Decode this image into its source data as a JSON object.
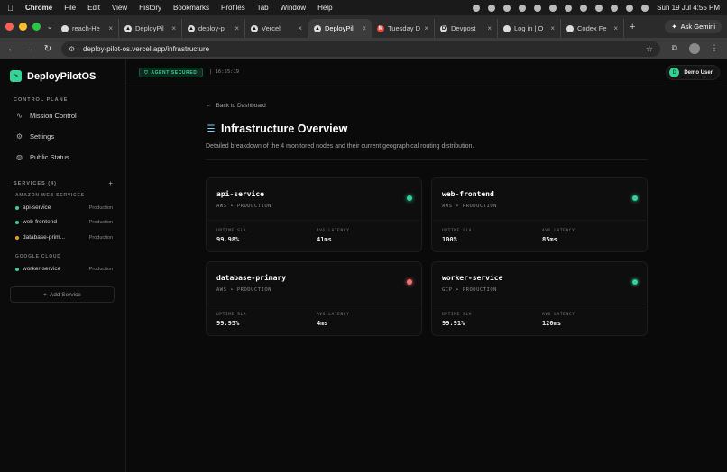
{
  "menubar": {
    "items": [
      "Chrome",
      "File",
      "Edit",
      "View",
      "History",
      "Bookmarks",
      "Profiles",
      "Tab",
      "Window",
      "Help"
    ],
    "datetime": "Sun 19 Jul  4:55 PM"
  },
  "tabs": [
    {
      "title": "reach-He",
      "icon": "github-icon"
    },
    {
      "title": "DeployPil",
      "icon": "vercel-icon"
    },
    {
      "title": "deploy-pi",
      "icon": "vercel-icon"
    },
    {
      "title": "Vercel",
      "icon": "vercel-icon"
    },
    {
      "title": "DeployPil",
      "icon": "vercel-icon",
      "active": true
    },
    {
      "title": "Tuesday D",
      "icon": "gmail-icon"
    },
    {
      "title": "Devpost",
      "icon": "devpost-icon"
    },
    {
      "title": "Log in | O",
      "icon": "openai-icon"
    },
    {
      "title": "Codex Fe",
      "icon": "codex-icon"
    }
  ],
  "gemini_label": "Ask Gemini",
  "address": "deploy-pilot-os.vercel.app/infrastructure",
  "brand": {
    "name": "DeployPilotOS"
  },
  "sidebar": {
    "control_plane_label": "CONTROL PLANE",
    "nav": [
      {
        "label": "Mission Control",
        "icon": "activity-icon"
      },
      {
        "label": "Settings",
        "icon": "gear-icon"
      },
      {
        "label": "Public Status",
        "icon": "globe-icon"
      }
    ],
    "services_label": "SERVICES (4)",
    "groups": [
      {
        "label": "AMAZON WEB SERVICES",
        "services": [
          {
            "name": "api-service",
            "env": "Production",
            "status_color": "#34d399"
          },
          {
            "name": "web-frontend",
            "env": "Production",
            "status_color": "#34d399"
          },
          {
            "name": "database-prim...",
            "env": "Production",
            "status_color": "#f59e0b"
          }
        ]
      },
      {
        "label": "GOOGLE CLOUD",
        "services": [
          {
            "name": "worker-service",
            "env": "Production",
            "status_color": "#34d399"
          }
        ]
      }
    ],
    "add_service": "Add Service"
  },
  "topbar": {
    "agent_badge": "AGENT SECURED",
    "time": "| 16:55:19",
    "user": "Demo User",
    "user_initial": "D"
  },
  "main": {
    "back_label": "Back to Dashboard",
    "title": "Infrastructure Overview",
    "subtitle": "Detailed breakdown of the 4 monitored nodes and their current geographical routing distribution.",
    "cards": [
      {
        "name": "api-service",
        "meta": "AWS • PRODUCTION",
        "uptime_label": "UPTIME SLA",
        "uptime": "99.98%",
        "latency_label": "AVG LATENCY",
        "latency": "41ms",
        "status_color": "#34d399"
      },
      {
        "name": "web-frontend",
        "meta": "AWS • PRODUCTION",
        "uptime_label": "UPTIME SLA",
        "uptime": "100%",
        "latency_label": "AVG LATENCY",
        "latency": "85ms",
        "status_color": "#34d399"
      },
      {
        "name": "database-primary",
        "meta": "AWS • PRODUCTION",
        "uptime_label": "UPTIME SLA",
        "uptime": "99.95%",
        "latency_label": "AVG LATENCY",
        "latency": "4ms",
        "status_color": "#f87171"
      },
      {
        "name": "worker-service",
        "meta": "GCP • PRODUCTION",
        "uptime_label": "UPTIME SLA",
        "uptime": "99.91%",
        "latency_label": "AVG LATENCY",
        "latency": "120ms",
        "status_color": "#34d399"
      }
    ]
  }
}
